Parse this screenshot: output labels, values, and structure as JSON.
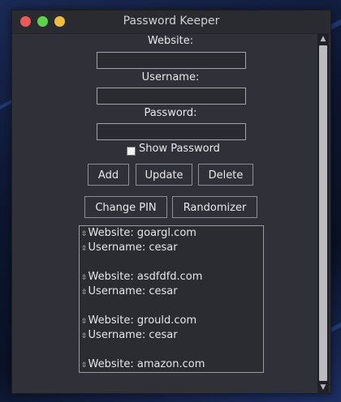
{
  "window": {
    "title": "Password Keeper"
  },
  "form": {
    "website_label": "Website:",
    "username_label": "Username:",
    "password_label": "Password:",
    "website_value": "",
    "username_value": "",
    "password_value": "",
    "show_password_label": "Show Password"
  },
  "buttons": {
    "add": "Add",
    "update": "Update",
    "delete": "Delete",
    "change_pin": "Change PIN",
    "randomizer": "Randomizer"
  },
  "entries": [
    {
      "website": "Website: goargl.com",
      "username": "Username: cesar"
    },
    {
      "website": "Website: asdfdfd.com",
      "username": "Username: cesar"
    },
    {
      "website": "Website: grould.com",
      "username": "Username: cesar"
    },
    {
      "website": "Website: amazon.com",
      "username": ""
    }
  ],
  "icons": {
    "row": "diamond-arrow-icon",
    "scroll_up": "up-arrow-icon",
    "scroll_down": "down-arrow-icon"
  }
}
